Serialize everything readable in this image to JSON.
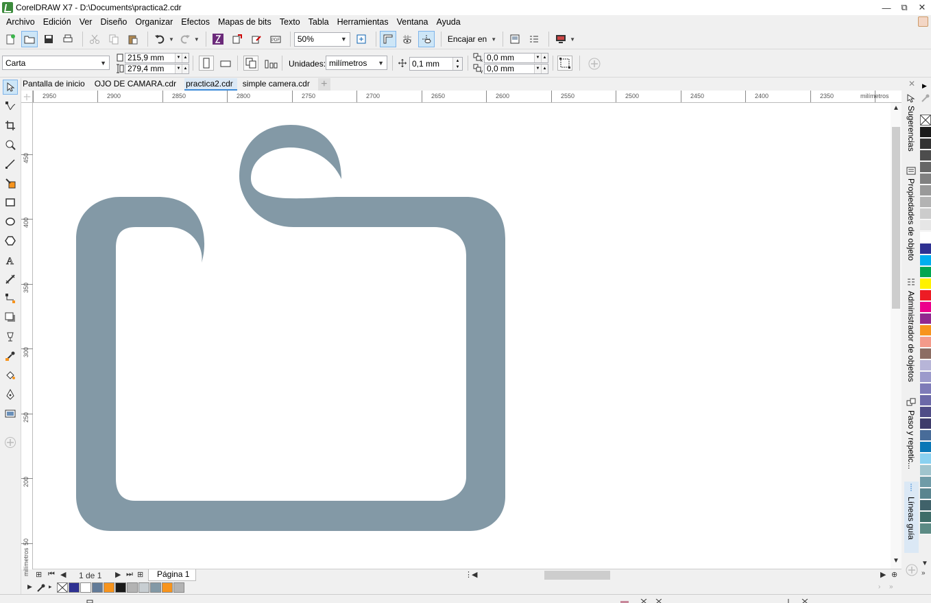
{
  "window": {
    "title": "CorelDRAW X7 - D:\\Documents\\practica2.cdr",
    "controls": [
      "—",
      "⧉",
      "✕"
    ]
  },
  "menu": [
    "Archivo",
    "Edición",
    "Ver",
    "Diseño",
    "Organizar",
    "Efectos",
    "Mapas de bits",
    "Texto",
    "Tabla",
    "Herramientas",
    "Ventana",
    "Ayuda"
  ],
  "toolbar": {
    "zoom_value": "50%",
    "snap_label": "Encajar en"
  },
  "property_bar": {
    "page_size": "Carta",
    "width": "215,9 mm",
    "height": "279,4 mm",
    "units_label": "Unidades:",
    "units_value": "milímetros",
    "nudge": "0,1 mm",
    "dup_x": "0,0 mm",
    "dup_y": "0,0 mm"
  },
  "tabs": [
    {
      "label": "Pantalla de inicio",
      "active": false
    },
    {
      "label": "OJO DE CAMARA.cdr",
      "active": false
    },
    {
      "label": "practica2.cdr",
      "active": true
    },
    {
      "label": "simple camera.cdr",
      "active": false
    }
  ],
  "ruler": {
    "h_labels": [
      "2950",
      "2900",
      "2850",
      "2800",
      "2750",
      "2700",
      "2650",
      "2600",
      "2550",
      "2500",
      "2450",
      "2400",
      "2350",
      "milímetros"
    ],
    "v_labels": [
      "450",
      "400",
      "350",
      "300",
      "250",
      "200",
      "50",
      "milímetros"
    ]
  },
  "page_nav": {
    "counter": "1 de 1",
    "page_tab": "Página 1"
  },
  "dockers": [
    "Sugerencias",
    "Propiedades de objeto",
    "Administrador de objetos",
    "Paso y repetic...",
    "Líneas guía"
  ],
  "shape_color": "#8399a6",
  "palette_colors": [
    "#ffffff",
    "#1a1a1a",
    "#333333",
    "#4d4d4d",
    "#666666",
    "#808080",
    "#999999",
    "#b3b3b3",
    "#cccccc",
    "#e6e6e6",
    "#ffffff",
    "#2e3192",
    "#00aeef",
    "#00a651",
    "#fff200",
    "#ed1c24",
    "#ec008c",
    "#92278f",
    "#f7941d",
    "#f49a8a",
    "#8c6d63",
    "#b7b5d8",
    "#9c9acb",
    "#7e7bb8",
    "#6c69a8",
    "#4f4c86",
    "#3e3c6b",
    "#486c99",
    "#0a77b6",
    "#8ad1f0",
    "#a0c4cd",
    "#6f9ba7",
    "#5a858f",
    "#40626a",
    "#3f6d69",
    "#5c8b85"
  ],
  "doc_palette_colors": [
    "#2e3192",
    "#ffffff",
    "#627b98",
    "#f7941d",
    "#1a1a1a",
    "#b3b3b3",
    "#c8ced2",
    "#8399a6",
    "#f7941d",
    "#b3b3b3"
  ]
}
